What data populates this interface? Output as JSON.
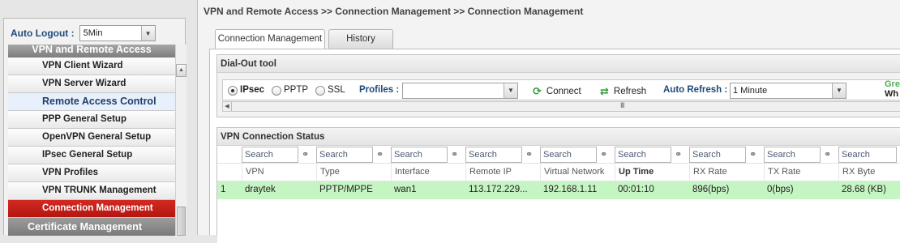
{
  "sidebar": {
    "auto_logout_label": "Auto Logout :",
    "auto_logout_value": "5Min",
    "section_header": "VPN and Remote Access",
    "items": [
      {
        "label": "VPN Client Wizard"
      },
      {
        "label": "VPN Server Wizard"
      },
      {
        "label": "Remote Access Control"
      },
      {
        "label": "PPP General Setup"
      },
      {
        "label": "OpenVPN General Setup"
      },
      {
        "label": "IPsec General Setup"
      },
      {
        "label": "VPN Profiles"
      },
      {
        "label": "VPN TRUNK Management"
      },
      {
        "label": "Connection Management"
      }
    ],
    "footer": "Certificate Management"
  },
  "breadcrumb": "VPN and Remote Access >> Connection Management >> Connection Management",
  "tabs": [
    {
      "label": "Connection Management"
    },
    {
      "label": "History"
    }
  ],
  "dialout": {
    "title": "Dial-Out tool",
    "options": [
      {
        "label": "IPsec",
        "selected": true
      },
      {
        "label": "PPTP",
        "selected": false
      },
      {
        "label": "SSL",
        "selected": false
      }
    ],
    "profiles_label": "Profiles :",
    "profiles_value": "",
    "connect_label": "Connect",
    "refresh_label": "Refresh",
    "auto_refresh_label": "Auto Refresh :",
    "auto_refresh_value": "1 Minute",
    "legend_green": "Gre",
    "legend_white": "Wh",
    "scroll_grip": "III"
  },
  "status": {
    "title": "VPN Connection Status",
    "search_placeholder": "Search",
    "columns": [
      "VPN",
      "Type",
      "Interface",
      "Remote IP",
      "Virtual Network",
      "Up Time",
      "RX Rate",
      "TX Rate",
      "RX Byte"
    ],
    "rows": [
      {
        "no": "1",
        "vpn": "draytek",
        "type": "PPTP/MPPE",
        "interface": "wan1",
        "remote_ip": "113.172.229...",
        "virtual_network": "192.168.1.11",
        "up_time": "00:01:10",
        "rx_rate": "896(bps)",
        "tx_rate": "0(bps)",
        "rx_byte": "28.68 (KB)"
      }
    ]
  },
  "colors": {
    "accent_red": "#c41e17",
    "label_blue": "#1f4a7a",
    "row_green": "#c5f5c2",
    "icon_green": "#2e9c3a"
  }
}
